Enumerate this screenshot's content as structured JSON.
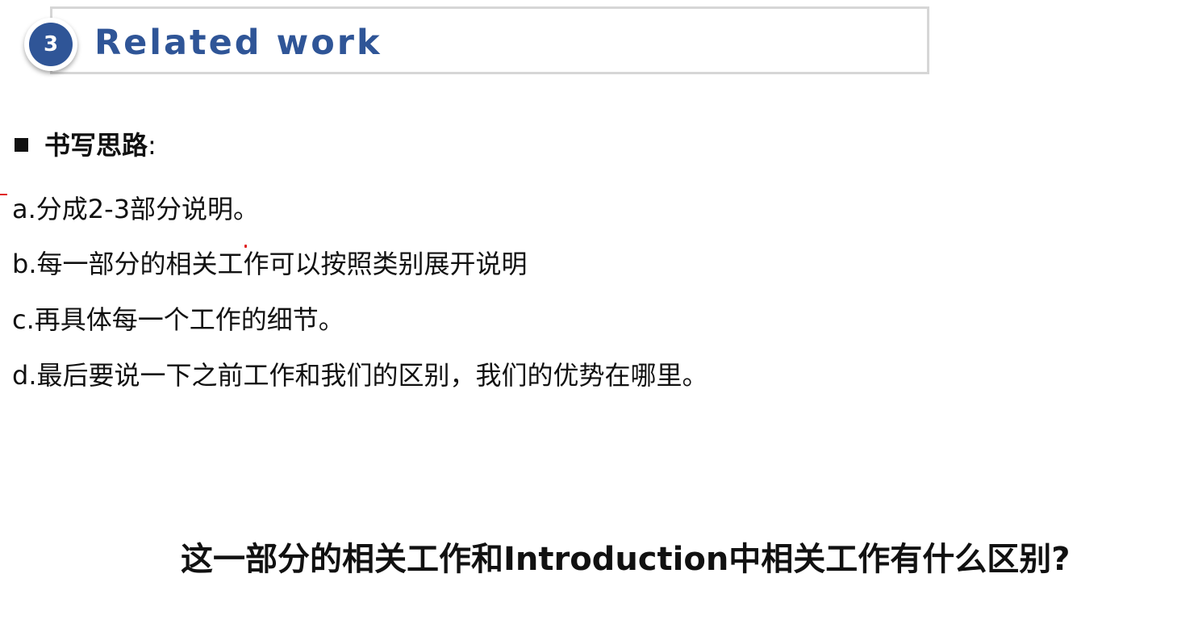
{
  "section": {
    "number": "3",
    "title": "Related work"
  },
  "subheading": {
    "label": "书写思路",
    "colon": ":"
  },
  "points": [
    "a.分成2-3部分说明。",
    "b.每一部分的相关工作可以按照类别展开说明",
    "c.再具体每一个工作的细节。",
    "d.最后要说一下之前工作和我们的区别，我们的优势在哪里。"
  ],
  "question": "这一部分的相关工作和Introduction中相关工作有什么区别?",
  "colors": {
    "accent": "#2f5597",
    "annotation": "#e02020",
    "text": "#111111",
    "header_border": "#d6d6d6"
  },
  "icons": {
    "bullet": "square-bullet-icon"
  }
}
